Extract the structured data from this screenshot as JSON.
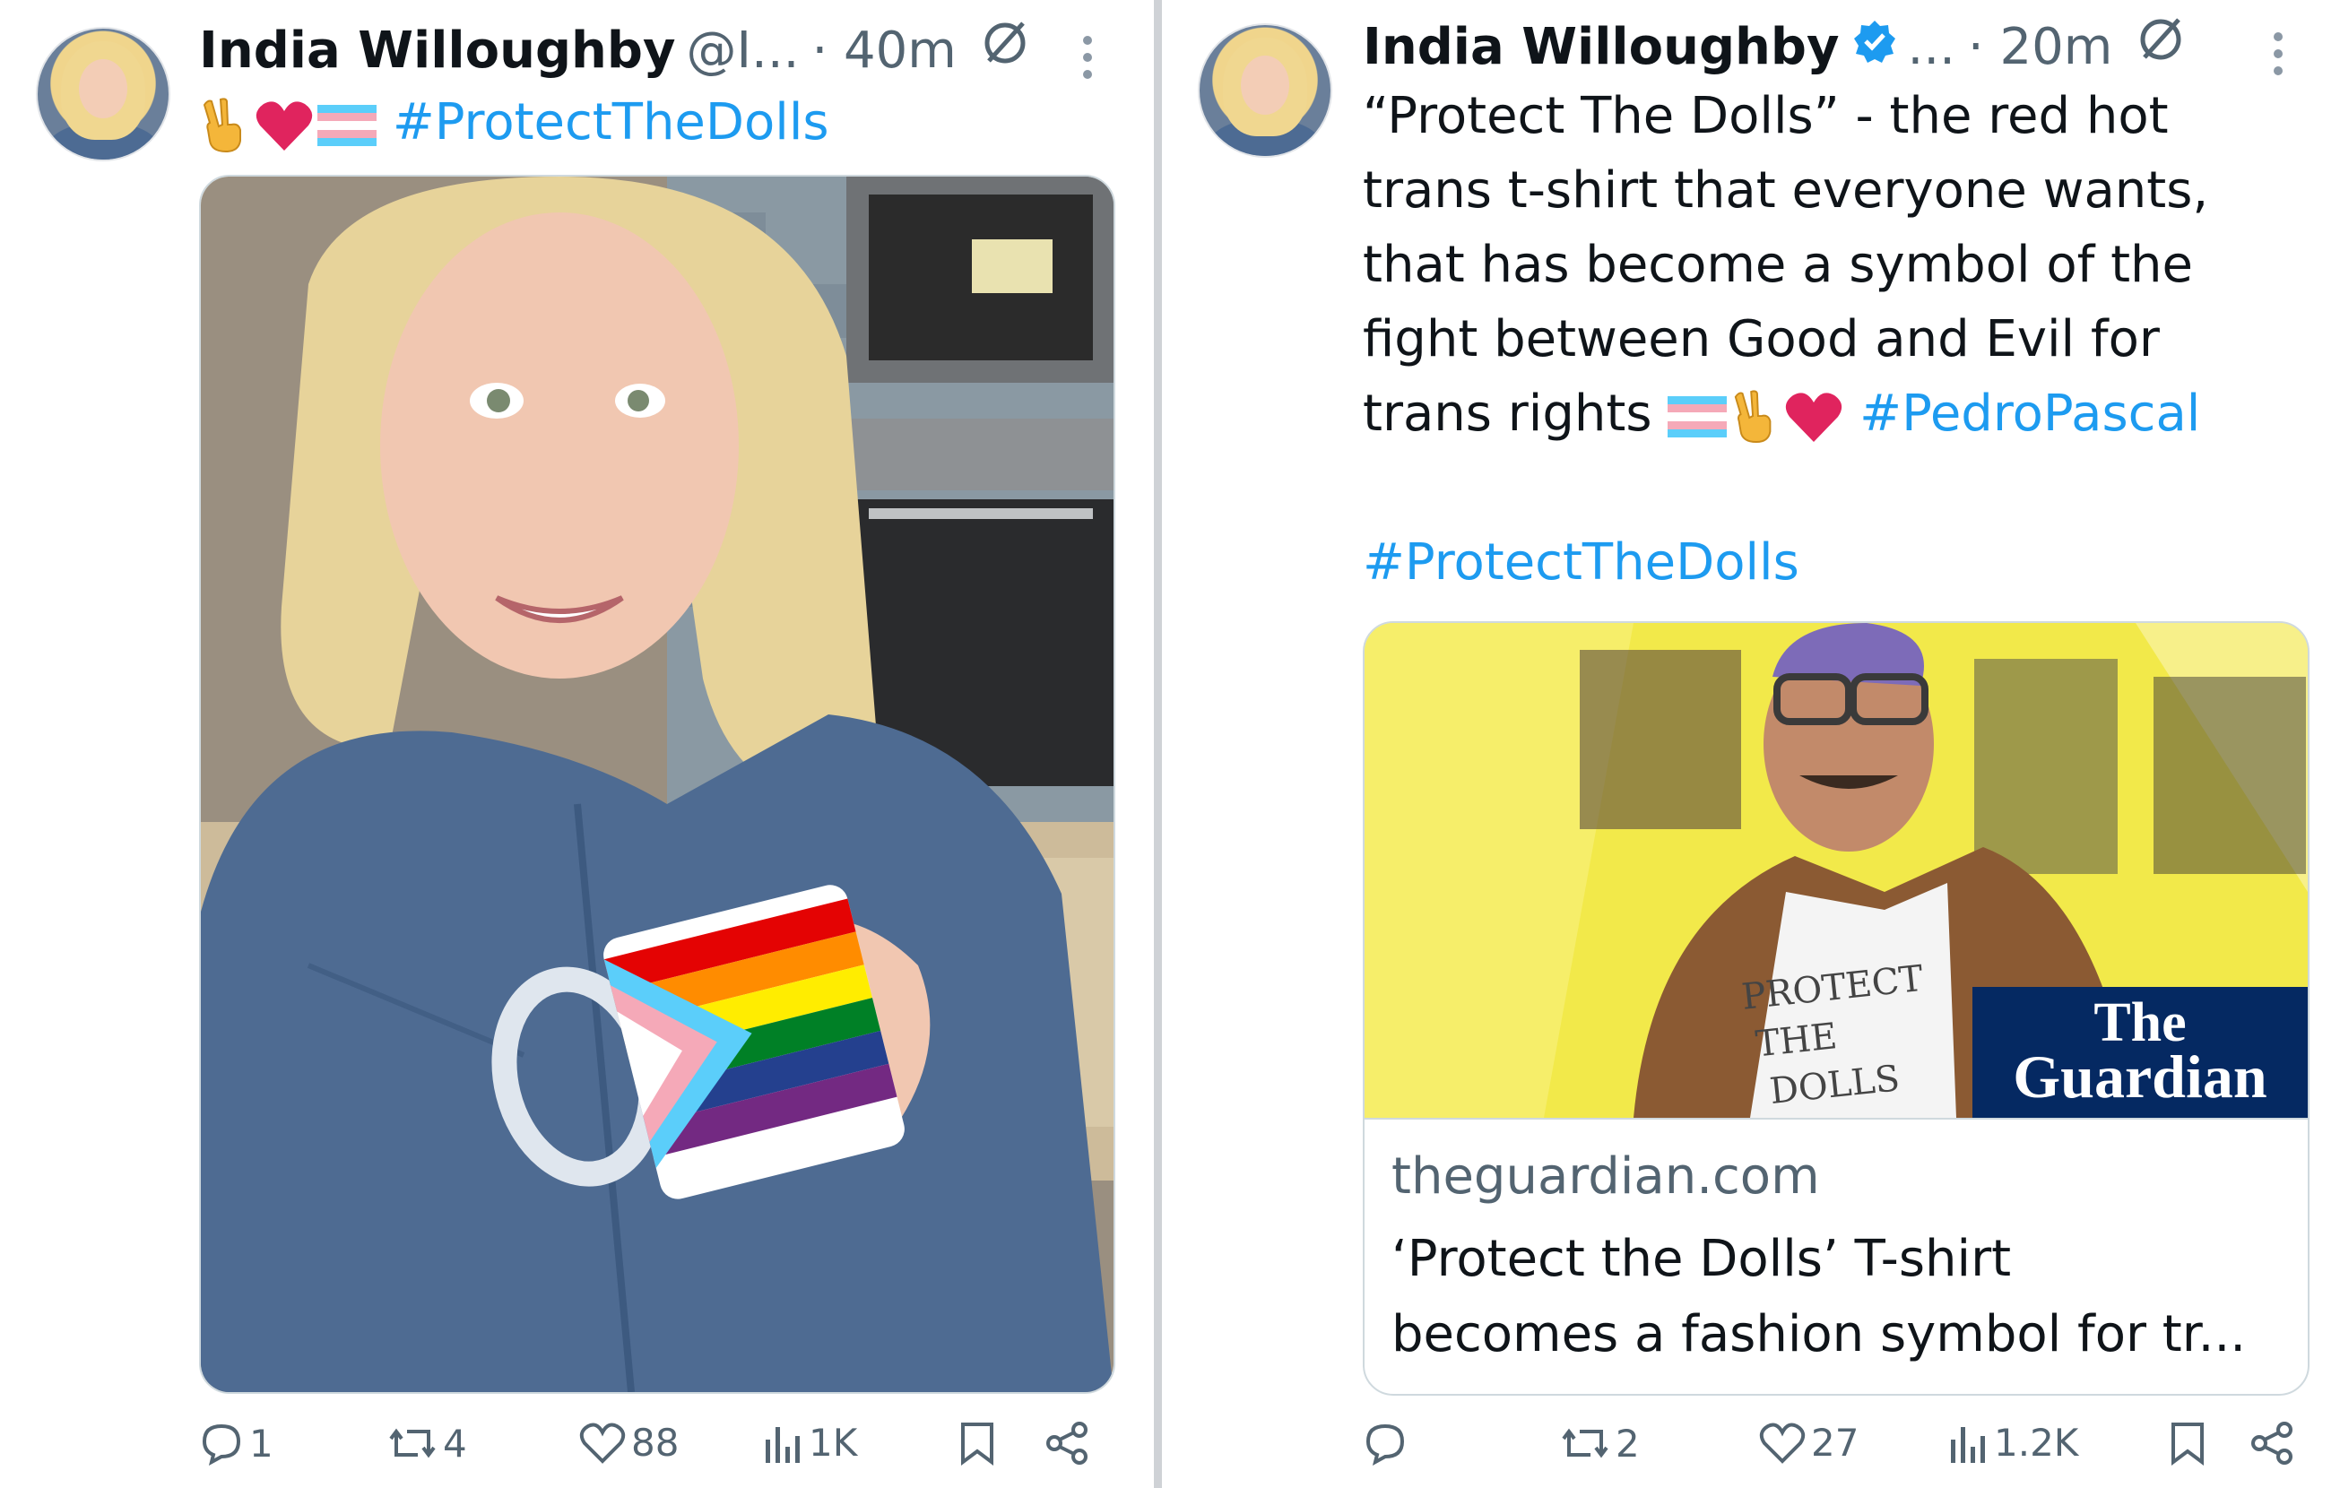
{
  "colors": {
    "accent": "#1d9bf0",
    "text": "#0f1419",
    "muted": "#536471",
    "divider": "#cfd2d6"
  },
  "left_tweet": {
    "display_name": "India Willoughby",
    "handle": "@I...",
    "time": "· 40m",
    "emoji": [
      "victory-hand",
      "red-heart",
      "transgender-flag"
    ],
    "hashtag": "#ProtectTheDolls",
    "media_description_icon": "photo",
    "actions": {
      "replies": "1",
      "reposts": "4",
      "likes": "88",
      "views": "1K"
    }
  },
  "right_tweet": {
    "display_name": "India Willoughby",
    "handle": "...",
    "time": "· 20m",
    "text_lines": [
      "“Protect The Dolls” - the red hot",
      "trans t-shirt that everyone wants,",
      "that has become a symbol of the",
      "fight between Good and Evil for",
      "trans rights"
    ],
    "inline_hashtag": "#PedroPascal",
    "hashtag": "#ProtectTheDolls",
    "card": {
      "shirt_text": [
        "PROTECT",
        "THE",
        "DOLLS"
      ],
      "logo": [
        "The",
        "Guardian"
      ],
      "domain": "theguardian.com",
      "title_lines": [
        "‘Protect the Dolls’ T-shirt",
        "becomes a fashion symbol for tr..."
      ]
    },
    "actions": {
      "replies": "",
      "reposts": "2",
      "likes": "27",
      "views": "1.2K"
    }
  }
}
